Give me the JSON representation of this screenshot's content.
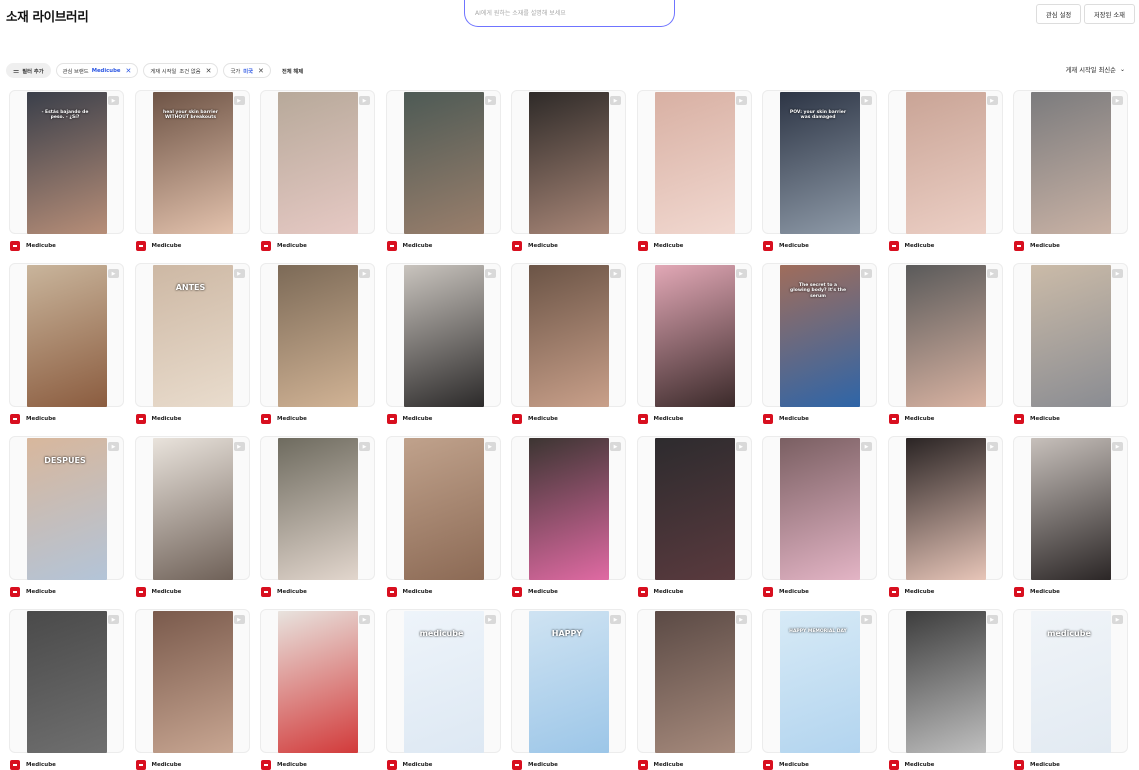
{
  "header": {
    "title": "소재 라이브러리",
    "search_placeholder": "AI에게 원하는 소재를 설명해 보세요",
    "interest_button": "관심 설정",
    "saved_button": "저장된 소재"
  },
  "filters": {
    "add_label": "필터 추가",
    "chips": [
      {
        "label": "관심 브랜드",
        "value": "Medicube",
        "value_color": "#2b56e3"
      },
      {
        "label": "게재 시작일",
        "value": "조건 없음",
        "value_color": "#333333"
      },
      {
        "label": "국가",
        "value": "미국",
        "value_color": "#2b56e3"
      }
    ],
    "reset_label": "전체 해제"
  },
  "sort": {
    "label": "게재 시작일 최신순"
  },
  "brand": {
    "name": "Medicube",
    "color": "#d80f1f"
  },
  "accent_color": "#6f74ff",
  "cards": [
    {
      "brand": "Medicube",
      "caption": "- Estás bajando de peso. - ¿Sí?",
      "tone": [
        "#3a3f4a",
        "#b78e78"
      ]
    },
    {
      "brand": "Medicube",
      "caption": "heal your skin barrier WITHOUT breakouts",
      "tone": [
        "#6e5446",
        "#e3c2ad"
      ]
    },
    {
      "brand": "Medicube",
      "caption": "",
      "tone": [
        "#b7a99a",
        "#e6c9c4"
      ]
    },
    {
      "brand": "Medicube",
      "caption": "",
      "tone": [
        "#4d5a55",
        "#9a7f6c"
      ]
    },
    {
      "brand": "Medicube",
      "caption": "",
      "tone": [
        "#2e2a28",
        "#a98778"
      ]
    },
    {
      "brand": "Medicube",
      "caption": "",
      "tone": [
        "#d8b0a3",
        "#f1d8d0"
      ]
    },
    {
      "brand": "Medicube",
      "caption": "POV: your skin barrier was damaged",
      "tone": [
        "#2d3545",
        "#8e9aa8"
      ]
    },
    {
      "brand": "Medicube",
      "caption": "",
      "tone": [
        "#c9a496",
        "#eccfc5"
      ]
    },
    {
      "brand": "Medicube",
      "caption": "",
      "tone": [
        "#7b7b7d",
        "#c9b2a5"
      ]
    },
    {
      "brand": "Medicube",
      "caption": "",
      "tone": [
        "#c9b59c",
        "#8b5c3f"
      ]
    },
    {
      "brand": "Medicube",
      "caption": "ANTES",
      "tone": [
        "#cdb8a4",
        "#e9dccd"
      ]
    },
    {
      "brand": "Medicube",
      "caption": "",
      "tone": [
        "#7c6a57",
        "#d1b395"
      ]
    },
    {
      "brand": "Medicube",
      "caption": "",
      "tone": [
        "#c9c4be",
        "#2c2a2a"
      ]
    },
    {
      "brand": "Medicube",
      "caption": "",
      "tone": [
        "#6b5446",
        "#c9a08a"
      ]
    },
    {
      "brand": "Medicube",
      "caption": "",
      "tone": [
        "#e2a8b6",
        "#3b2a2a"
      ]
    },
    {
      "brand": "Medicube",
      "caption": "The secret to a glowing body? It's the serum",
      "tone": [
        "#a06d5b",
        "#2e65a8"
      ]
    },
    {
      "brand": "Medicube",
      "caption": "",
      "tone": [
        "#5a5a5a",
        "#d9b3a2"
      ]
    },
    {
      "brand": "Medicube",
      "caption": "",
      "tone": [
        "#cbbba8",
        "#8a8c92"
      ]
    },
    {
      "brand": "Medicube",
      "caption": "DESPUES",
      "tone": [
        "#d8b79c",
        "#b3c4d8"
      ]
    },
    {
      "brand": "Medicube",
      "caption": "",
      "tone": [
        "#e9e3dc",
        "#6f6158"
      ]
    },
    {
      "brand": "Medicube",
      "caption": "",
      "tone": [
        "#6e6b5f",
        "#e2d6cd"
      ]
    },
    {
      "brand": "Medicube",
      "caption": "",
      "tone": [
        "#c0a28c",
        "#8c6a55"
      ]
    },
    {
      "brand": "Medicube",
      "caption": "",
      "tone": [
        "#3c3532",
        "#e06aa3"
      ]
    },
    {
      "brand": "Medicube",
      "caption": "",
      "tone": [
        "#2d2b2e",
        "#5a3a3e"
      ]
    },
    {
      "brand": "Medicube",
      "caption": "",
      "tone": [
        "#7a5f62",
        "#e3b4c5"
      ]
    },
    {
      "brand": "Medicube",
      "caption": "",
      "tone": [
        "#2a2424",
        "#e7c5b8"
      ]
    },
    {
      "brand": "Medicube",
      "caption": "",
      "tone": [
        "#c7c0bb",
        "#2b2626"
      ]
    },
    {
      "brand": "Medicube",
      "caption": "",
      "tone": [
        "#4a4a4a",
        "#6f6f6f"
      ]
    },
    {
      "brand": "Medicube",
      "caption": "",
      "tone": [
        "#7a5a4c",
        "#c8a692"
      ]
    },
    {
      "brand": "Medicube",
      "caption": "",
      "tone": [
        "#e8e3de",
        "#d23a3a"
      ]
    },
    {
      "brand": "Medicube",
      "caption": "medicube",
      "tone": [
        "#eef4fa",
        "#dde8f3"
      ]
    },
    {
      "brand": "Medicube",
      "caption": "HAPPY",
      "tone": [
        "#cfe3f2",
        "#9cc6e8"
      ]
    },
    {
      "brand": "Medicube",
      "caption": "",
      "tone": [
        "#5b4a45",
        "#a68a7c"
      ]
    },
    {
      "brand": "Medicube",
      "caption": "HAPPY MEMORIAL DAY",
      "tone": [
        "#d7eaf6",
        "#b2d4ef"
      ]
    },
    {
      "brand": "Medicube",
      "caption": "",
      "tone": [
        "#3d3d3d",
        "#bfbfbf"
      ]
    },
    {
      "brand": "Medicube",
      "caption": "medicube",
      "tone": [
        "#f0f4f8",
        "#e2eaf2"
      ]
    }
  ]
}
